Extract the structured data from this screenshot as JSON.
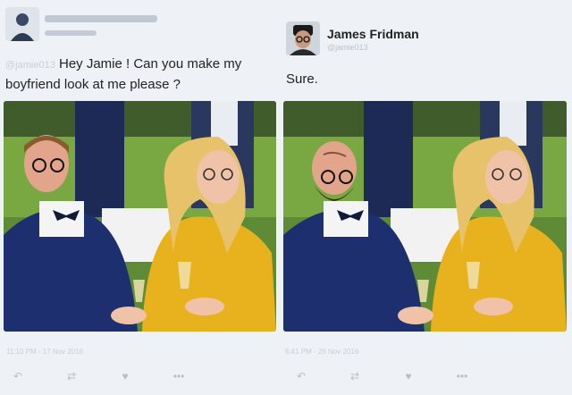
{
  "left_tweet": {
    "avatar_icon": "user-avatar-icon",
    "handle": "@jamie013",
    "text_after_mention": "Hey Jamie ! Can you make my boyfriend look at me please ?",
    "timestamp": "11:10 PM - 17 Nov 2016",
    "actions": [
      "reply-icon",
      "retweet-icon",
      "like-icon",
      "more-icon"
    ]
  },
  "right_tweet": {
    "avatar_icon": "user-avatar-icon",
    "display_name": "James Fridman",
    "handle": "@jamie013",
    "text": "Sure.",
    "timestamp": "6:41 PM - 26 Nov 2016",
    "actions": [
      "reply-icon",
      "retweet-icon",
      "like-icon",
      "more-icon"
    ]
  },
  "colors": {
    "background": "#eef2f6",
    "text": "#222222",
    "muted": "#c5ced8",
    "suit": "#1d2f6e",
    "dress": "#e8b21e",
    "grass": "#6b9a3a"
  }
}
